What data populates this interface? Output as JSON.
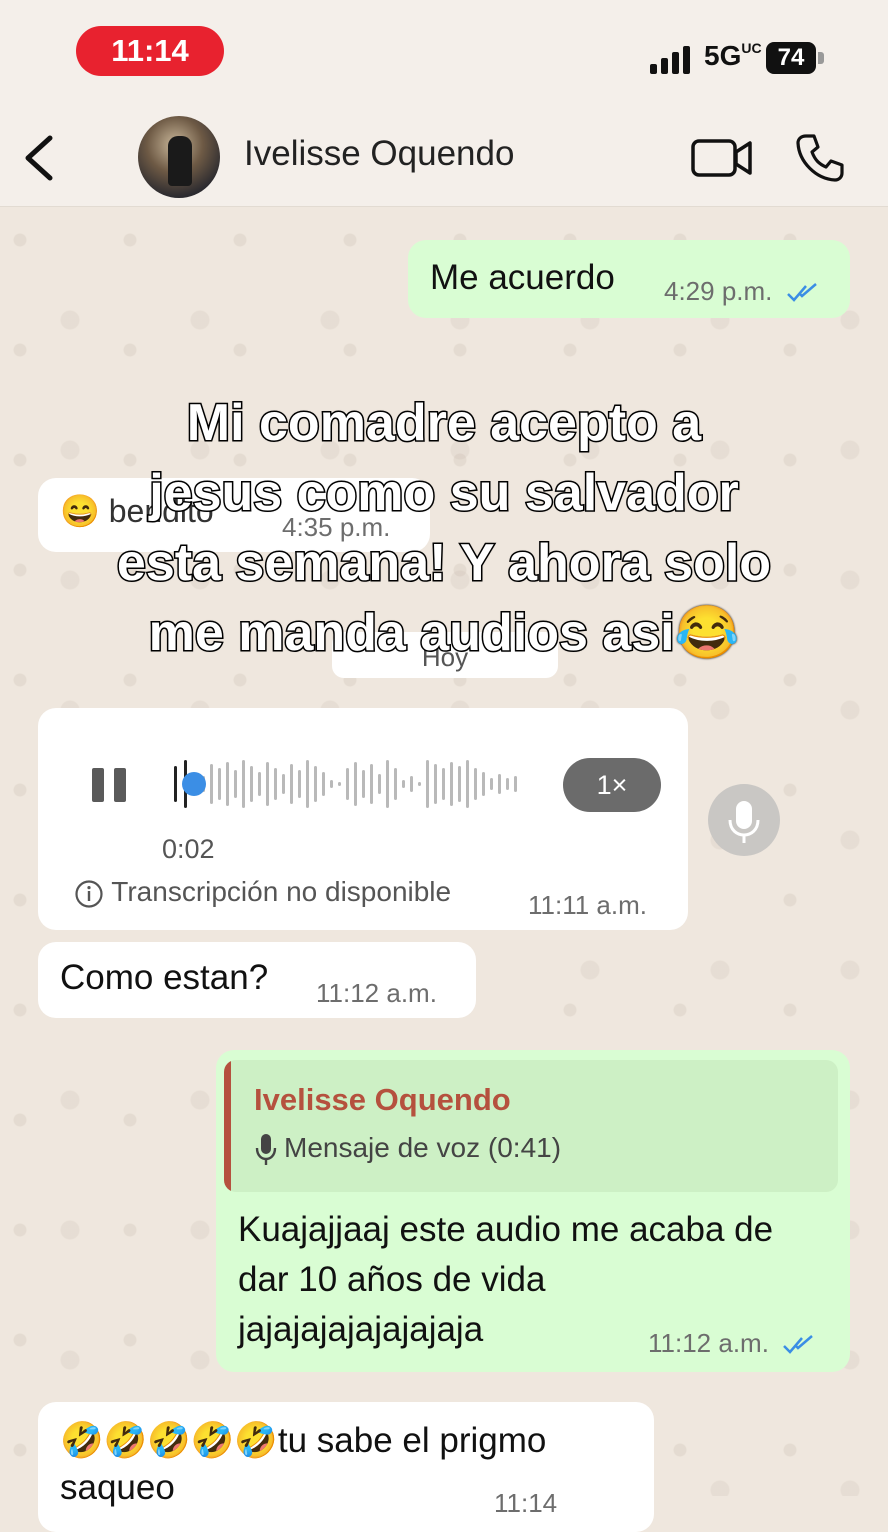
{
  "status_bar": {
    "time": "11:14",
    "network": "5G",
    "network_sup": "UC",
    "battery": "74"
  },
  "header": {
    "contact_name": "Ivelisse Oquendo"
  },
  "messages": {
    "m1": {
      "text": "Me acuerdo",
      "time": "4:29 p.m."
    },
    "m2": {
      "emoji": "😄",
      "text": "bendito",
      "time": "4:35 p.m."
    },
    "date_divider": "Hoy",
    "voice": {
      "duration": "0:02",
      "speed": "1×",
      "transcription": "Transcripción no disponible",
      "time": "11:11 a.m."
    },
    "m3": {
      "text": "Como estan?",
      "time": "11:12 a.m."
    },
    "m4": {
      "quote_name": "Ivelisse Oquendo",
      "quote_text": "Mensaje de voz (0:41)",
      "line1": "Kuajajjaaj este audio me acaba de",
      "line2": "dar 10 años de vida",
      "line3": "jajajajajajajajaja",
      "time": "11:12 a.m."
    },
    "m5": {
      "line1": "🤣🤣🤣🤣🤣tu sabe el prigmo",
      "line2": "saqueo",
      "time": "11:14"
    }
  },
  "caption": {
    "line1": "Mi comadre acepto a",
    "line2": "jesus como su salvador",
    "line3": "esta semana! Y ahora solo",
    "line4": "me manda audios asi😂"
  },
  "colors": {
    "outgoing_bubble": "#d9fdd3",
    "incoming_bubble": "#ffffff",
    "read_ticks": "#3b8ee5",
    "time_pill": "#e8222f",
    "quote_accent": "#b5513e"
  },
  "icons": [
    "back-chevron-icon",
    "video-call-icon",
    "phone-icon",
    "pause-icon",
    "microphone-icon",
    "info-icon",
    "double-check-icon"
  ]
}
